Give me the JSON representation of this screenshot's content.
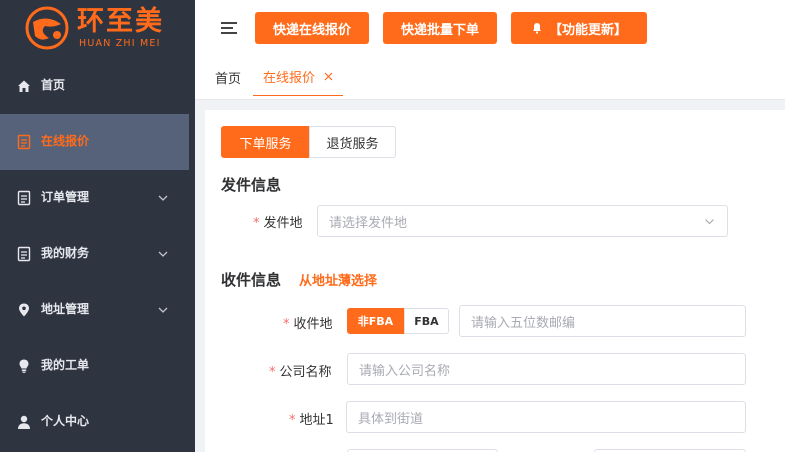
{
  "brand": {
    "title": "环至美",
    "subtitle": "HUAN ZHI MEI",
    "accent": "#ff6b1a",
    "sidebar_bg": "#2f3441"
  },
  "sidebar": {
    "items": [
      {
        "label": "首页",
        "icon": "home-icon",
        "active": false,
        "expandable": false
      },
      {
        "label": "在线报价",
        "icon": "document-icon",
        "active": true,
        "expandable": false
      },
      {
        "label": "订单管理",
        "icon": "document-icon",
        "active": false,
        "expandable": true
      },
      {
        "label": "我的财务",
        "icon": "document-icon",
        "active": false,
        "expandable": true
      },
      {
        "label": "地址管理",
        "icon": "location-icon",
        "active": false,
        "expandable": true
      },
      {
        "label": "我的工单",
        "icon": "lightbulb-icon",
        "active": false,
        "expandable": false
      },
      {
        "label": "个人中心",
        "icon": "user-icon",
        "active": false,
        "expandable": false
      }
    ]
  },
  "topbar": {
    "buttons": [
      {
        "label": "快递在线报价"
      },
      {
        "label": "快递批量下单"
      },
      {
        "label": "【功能更新】",
        "icon": "bell-icon"
      }
    ]
  },
  "tabs": {
    "items": [
      {
        "label": "首页",
        "active": false
      },
      {
        "label": "在线报价",
        "active": true,
        "closable": true
      }
    ]
  },
  "service_switch": {
    "options": [
      {
        "label": "下单服务",
        "selected": true
      },
      {
        "label": "退货服务",
        "selected": false
      }
    ]
  },
  "sender": {
    "title": "发件信息",
    "origin": {
      "label": "发件地",
      "placeholder": "请选择发件地"
    }
  },
  "recipient": {
    "title": "收件信息",
    "address_book_link": "从地址薄选择",
    "destination": {
      "label": "收件地",
      "type_options": [
        {
          "label": "非FBA",
          "selected": true
        },
        {
          "label": "FBA",
          "selected": false
        }
      ],
      "postcode_placeholder": "请输入五位数邮编"
    },
    "company": {
      "label": "公司名称",
      "placeholder": "请输入公司名称"
    },
    "address1": {
      "label": "地址1",
      "placeholder": "具体到街道"
    }
  }
}
